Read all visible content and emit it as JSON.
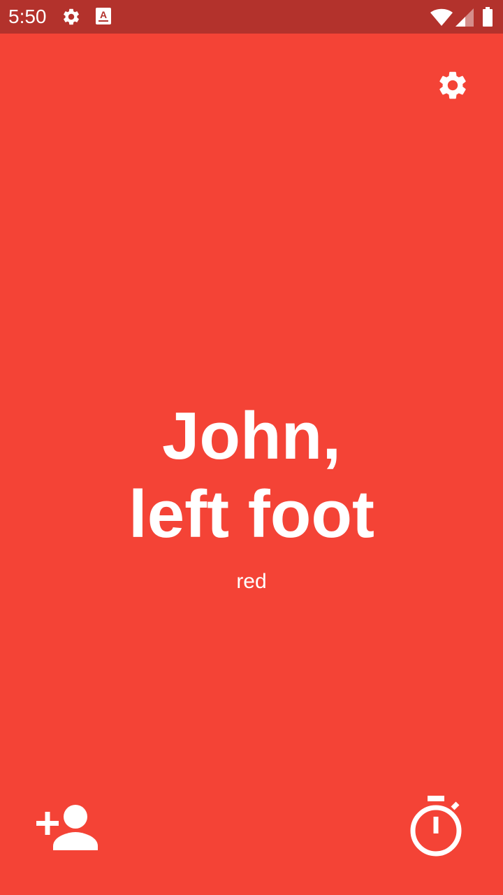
{
  "status_bar": {
    "time": "5:50",
    "icons": [
      "gear-icon",
      "a-box-icon",
      "wifi-icon",
      "signal-icon",
      "battery-icon"
    ],
    "background": "#B3322C"
  },
  "settings": {
    "icon": "gear-icon"
  },
  "main": {
    "line1": "John,",
    "line2": "left foot",
    "color_name": "red",
    "background": "#F44336"
  },
  "actions": {
    "add_player_icon": "person-add-icon",
    "timer_icon": "timer-icon"
  }
}
